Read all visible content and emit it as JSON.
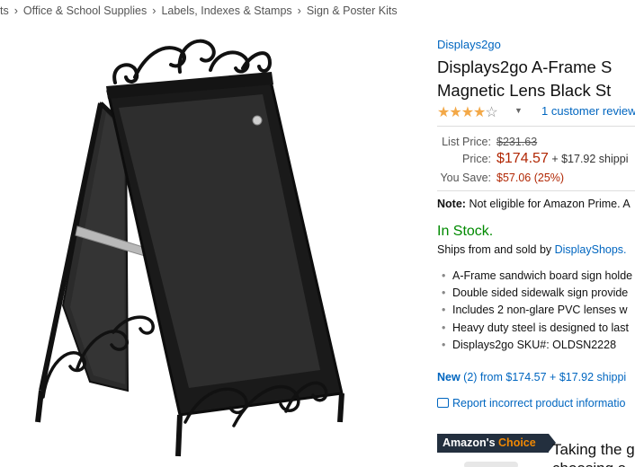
{
  "breadcrumb": {
    "items": [
      "ts",
      "Office & School Supplies",
      "Labels, Indexes & Stamps",
      "Sign & Poster Kits"
    ],
    "separator": "›"
  },
  "product": {
    "brand": "Displays2go",
    "title_line1": "Displays2go A-Frame S",
    "title_line2": "Magnetic Lens Black St",
    "rating_stars": 4,
    "rating_max": 5,
    "reviews_link": "1 customer review"
  },
  "pricing": {
    "list_price_label": "List Price:",
    "list_price": "$231.63",
    "price_label": "Price:",
    "price": "$174.57",
    "shipping": "+ $17.92 shippi",
    "save_label": "You Save:",
    "save_amount": "$57.06 (25%)"
  },
  "note": {
    "label": "Note:",
    "text": "Not eligible for Amazon Prime. A"
  },
  "availability": {
    "status": "In Stock.",
    "ships_text": "Ships from and sold by ",
    "seller": "DisplayShops."
  },
  "features": [
    "A-Frame sandwich board sign holde",
    "Double sided sidewalk sign provide",
    "Includes 2 non-glare PVC lenses w",
    "Heavy duty steel is designed to last",
    "Displays2go SKU#: OLDSN2228"
  ],
  "offers": {
    "new_label": "New",
    "new_text": " (2) from $174.57 + $17.92 shippi"
  },
  "report": {
    "text": "Report incorrect product informatio"
  },
  "badge": {
    "amazon": "Amazon's",
    "choice": "Choice",
    "text_line1": "Taking the g",
    "text_line2": "choosing a"
  },
  "colors": {
    "link": "#0066c0",
    "price": "#b12704",
    "in_stock": "#008a00",
    "star": "#f3a847",
    "badge_bg": "#232f3e",
    "badge_accent": "#f08804"
  }
}
